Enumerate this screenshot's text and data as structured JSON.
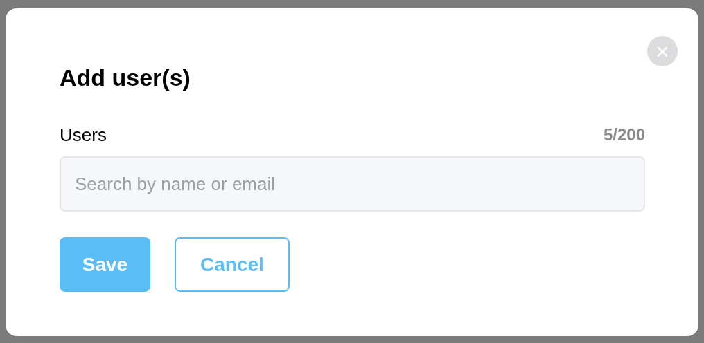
{
  "dialog": {
    "title": "Add user(s)",
    "close_icon": "×"
  },
  "users_field": {
    "label": "Users",
    "count": "5/200",
    "placeholder": "Search by name or email"
  },
  "buttons": [
    {
      "label": "Save",
      "kind": "primary"
    },
    {
      "label": "Cancel",
      "kind": "secondary"
    }
  ]
}
